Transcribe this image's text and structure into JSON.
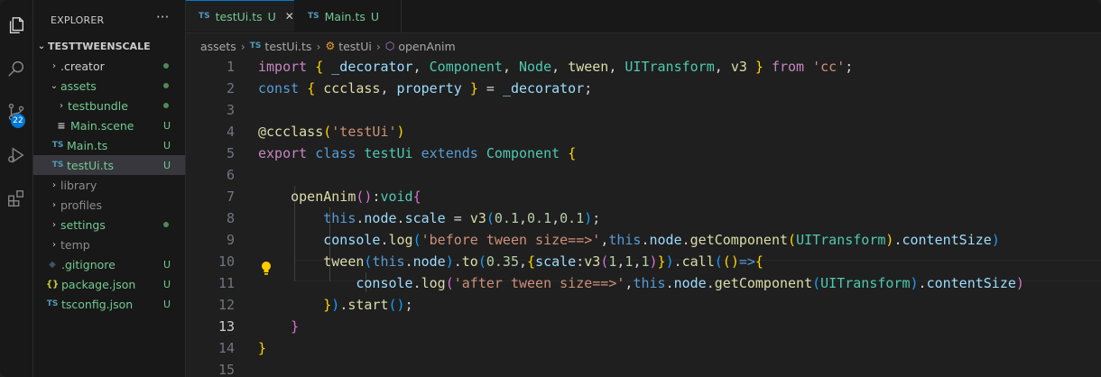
{
  "activity_bar": {
    "scm_badge": "22",
    "icons": [
      "explorer-icon",
      "search-icon",
      "source-control-icon",
      "run-debug-icon",
      "extensions-icon"
    ]
  },
  "sidebar": {
    "title": "EXPLORER",
    "more": "···",
    "root": "TESTTWEENSCALE",
    "items": [
      {
        "label": ".creator",
        "chevron": "›",
        "status": "dot"
      },
      {
        "label": "assets",
        "chevron": "⌄",
        "status": "dot"
      },
      {
        "label": "testbundle",
        "chevron": "›",
        "status": "dot"
      },
      {
        "label": "Main.scene",
        "icon": "≡",
        "status": "U"
      },
      {
        "label": "Main.ts",
        "icon": "TS",
        "status": "U"
      },
      {
        "label": "testUi.ts",
        "icon": "TS",
        "status": "U",
        "selected": true
      },
      {
        "label": "library",
        "chevron": "›"
      },
      {
        "label": "profiles",
        "chevron": "›"
      },
      {
        "label": "settings",
        "chevron": "›",
        "status": "dot"
      },
      {
        "label": "temp",
        "chevron": "›"
      },
      {
        "label": ".gitignore",
        "icon": "◆",
        "status": "U"
      },
      {
        "label": "package.json",
        "icon": "{}",
        "status": "U"
      },
      {
        "label": "tsconfig.json",
        "icon": "TS",
        "status": "U"
      }
    ]
  },
  "tabs": [
    {
      "icon": "TS",
      "label": "testUi.ts",
      "status": "U",
      "close": "✕",
      "active": true
    },
    {
      "icon": "TS",
      "label": "Main.ts",
      "status": "U",
      "active": false
    }
  ],
  "breadcrumbs": [
    "assets",
    "testUi.ts",
    "testUi",
    "openAnim"
  ],
  "editor": {
    "current_line": 13,
    "lines": [
      {
        "n": "1",
        "t": "import { _decorator, Component, Node, tween, UITransform, v3 } from 'cc';"
      },
      {
        "n": "2",
        "t": "const { ccclass, property } = _decorator;"
      },
      {
        "n": "3",
        "t": ""
      },
      {
        "n": "4",
        "t": "@ccclass('testUi')"
      },
      {
        "n": "5",
        "t": "export class testUi extends Component {"
      },
      {
        "n": "6",
        "t": ""
      },
      {
        "n": "7",
        "t": "    openAnim():void{"
      },
      {
        "n": "8",
        "t": "        this.node.scale = v3(0.1,0.1,0.1);"
      },
      {
        "n": "9",
        "t": "        console.log('before tween size==>',this.node.getComponent(UITransform).contentSize)"
      },
      {
        "n": "10",
        "t": "        tween(this.node).to(0.35,{scale:v3(1,1,1)}).call(()=>{"
      },
      {
        "n": "11",
        "t": "            console.log('after tween size==>',this.node.getComponent(UITransform).contentSize)"
      },
      {
        "n": "12",
        "t": "        }).start();"
      },
      {
        "n": "13",
        "t": "    }"
      },
      {
        "n": "14",
        "t": "}"
      },
      {
        "n": "15",
        "t": ""
      }
    ]
  },
  "colors": {
    "keyword": "#c586c0",
    "storage": "#569cd6",
    "function": "#dcdcaa",
    "type": "#4ec9b0",
    "variable": "#9cdcfe",
    "string": "#ce9178",
    "number": "#b5cea8",
    "untracked": "#73c991",
    "accent": "#0078d4"
  }
}
